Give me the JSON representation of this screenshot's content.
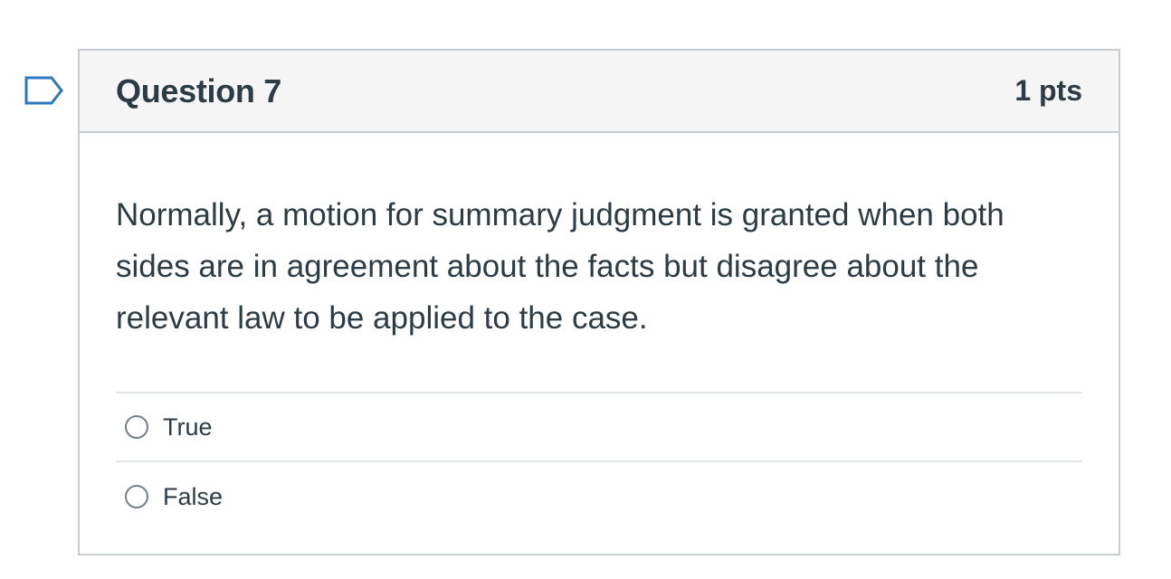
{
  "question": {
    "title": "Question 7",
    "points": "1 pts",
    "text": "Normally, a motion for summary judgment is granted when both sides are in agreement about the facts but disagree about the relevant law to be applied to the case.",
    "answers": [
      {
        "label": "True",
        "selected": false
      },
      {
        "label": "False",
        "selected": false
      }
    ]
  },
  "colors": {
    "flag_icon": "#2b7abc",
    "border": "#c7cdd1",
    "header_bg": "#f5f5f5",
    "text": "#2d3b45"
  },
  "icons": {
    "flag": "flag-question-icon"
  }
}
